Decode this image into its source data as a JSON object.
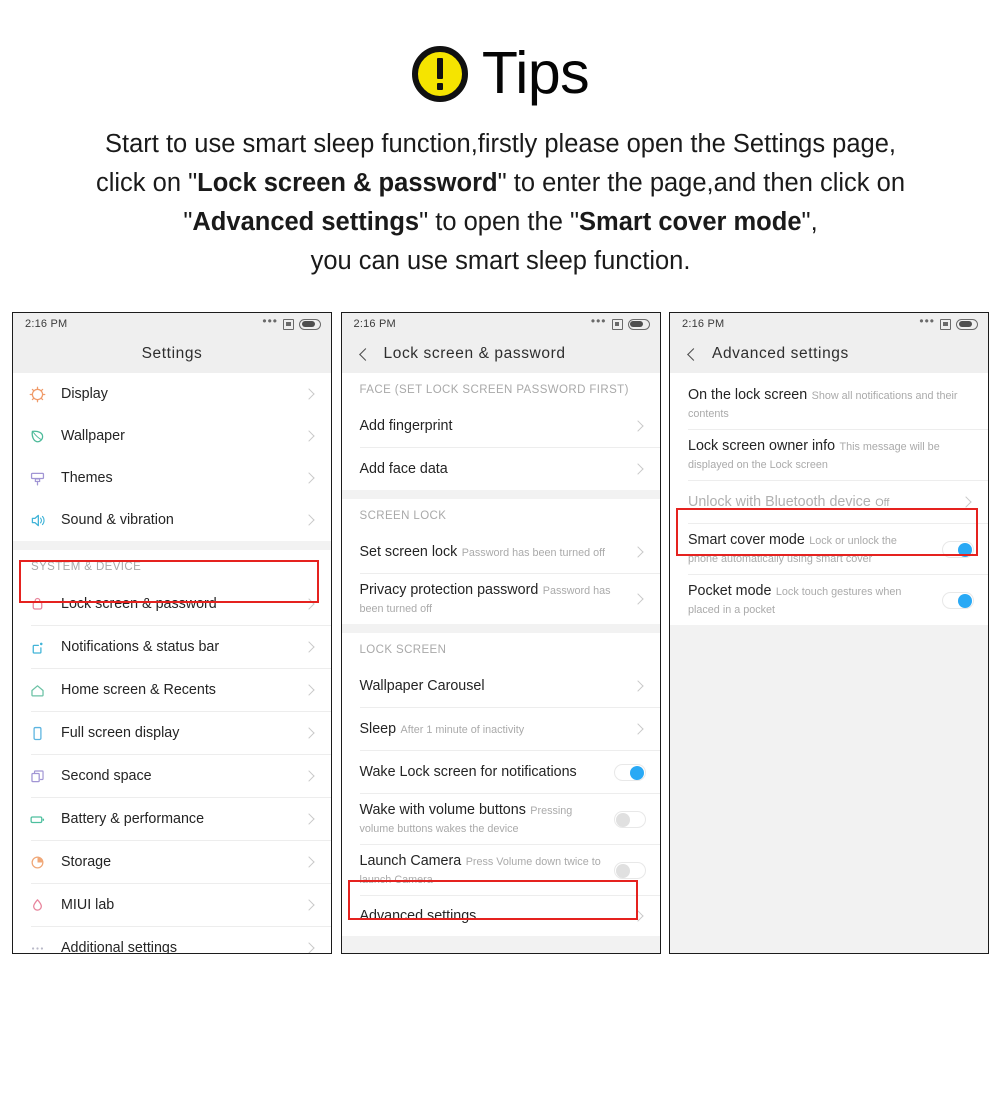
{
  "header": {
    "icon": "warning-exclamation-icon",
    "title": "Tips",
    "icon_color": "#f5e400",
    "icon_outline": "#111111"
  },
  "instructions": {
    "line1_a": "Start to use smart sleep function,firstly please open the Settings page,",
    "line2_a": "click on \"",
    "line2_bold": "Lock screen & password",
    "line2_b": "\" to enter the page,and then click on",
    "line3_a": "\"",
    "line3_bold1": "Advanced settings",
    "line3_b": "\" to open the \"",
    "line3_bold2": "Smart cover mode",
    "line3_c": "\",",
    "line4": "you can use smart sleep function."
  },
  "accent": {
    "highlight_red": "#e5221f",
    "toggle_blue": "#29a9f5"
  },
  "phone1": {
    "status": {
      "time": "2:16 PM",
      "dots": "•••"
    },
    "title": "Settings",
    "items": [
      {
        "label": "Display",
        "icon": "sun-icon",
        "color": "#f09b6a"
      },
      {
        "label": "Wallpaper",
        "icon": "leaf-icon",
        "color": "#4dba9a"
      },
      {
        "label": "Themes",
        "icon": "paint-brush-icon",
        "color": "#a195d4"
      },
      {
        "label": "Sound & vibration",
        "icon": "speaker-icon",
        "color": "#41b4d8"
      }
    ],
    "section_header": "SYSTEM & DEVICE",
    "items2": [
      {
        "label": "Lock screen & password",
        "icon": "lock-icon",
        "color": "#e8859c",
        "highlighted": true
      },
      {
        "label": "Notifications & status bar",
        "icon": "notification-square-icon",
        "color": "#41b4d8"
      },
      {
        "label": "Home screen & Recents",
        "icon": "home-icon",
        "color": "#6cc2a5"
      },
      {
        "label": "Full screen display",
        "icon": "phone-rect-icon",
        "color": "#5bb4e0"
      },
      {
        "label": "Second space",
        "icon": "two-squares-icon",
        "color": "#a195d4"
      },
      {
        "label": "Battery & performance",
        "icon": "battery-icon",
        "color": "#4dbf9e"
      },
      {
        "label": "Storage",
        "icon": "pie-chart-icon",
        "color": "#f0a878"
      },
      {
        "label": "MIUI lab",
        "icon": "flask-drop-icon",
        "color": "#e8849c"
      },
      {
        "label": "Additional settings",
        "icon": "ellipsis-icon",
        "color": "#b9b9c8"
      }
    ]
  },
  "phone2": {
    "status": {
      "time": "2:16 PM",
      "dots": "•••"
    },
    "title": "Lock screen & password",
    "back": "back-arrow",
    "section1_header": "FACE (SET LOCK SCREEN PASSWORD FIRST)",
    "section1": [
      {
        "label": "Add fingerprint"
      },
      {
        "label": "Add face data"
      }
    ],
    "section2_header": "SCREEN LOCK",
    "section2": [
      {
        "label": "Set screen lock",
        "sub": "Password has been turned off"
      },
      {
        "label": "Privacy protection password",
        "sub": "Password has been turned off"
      }
    ],
    "section3_header": "LOCK SCREEN",
    "section3": [
      {
        "label": "Wallpaper Carousel",
        "sub": "",
        "type": "chevron"
      },
      {
        "label": "Sleep",
        "sub": "After 1 minute of inactivity",
        "type": "chevron"
      },
      {
        "label": "Wake Lock screen for notifications",
        "sub": "",
        "type": "toggle",
        "on": true
      },
      {
        "label": "Wake with volume buttons",
        "sub": "Pressing volume buttons wakes the device",
        "type": "toggle",
        "on": false
      },
      {
        "label": "Launch Camera",
        "sub": "Press Volume down twice to launch Camera",
        "type": "toggle",
        "on": false
      },
      {
        "label": "Advanced settings",
        "sub": "",
        "type": "chevron",
        "highlighted": true
      }
    ]
  },
  "phone3": {
    "status": {
      "time": "2:16 PM",
      "dots": "•••"
    },
    "title": "Advanced settings",
    "back": "back-arrow",
    "items": [
      {
        "label": "On the lock screen",
        "sub": "Show all notifications and their contents",
        "type": "plain"
      },
      {
        "label": "Lock screen owner info",
        "sub": "This message will be displayed on the Lock screen",
        "type": "plain"
      },
      {
        "label": "Unlock with Bluetooth device",
        "sub": "Off",
        "type": "chevron",
        "dim": true
      },
      {
        "label": "Smart cover mode",
        "sub": "Lock or unlock the phone automatically using smart cover",
        "type": "toggle",
        "on": true,
        "highlighted": true
      },
      {
        "label": "Pocket mode",
        "sub": "Lock touch gestures when placed in a pocket",
        "type": "toggle",
        "on": true
      }
    ]
  }
}
